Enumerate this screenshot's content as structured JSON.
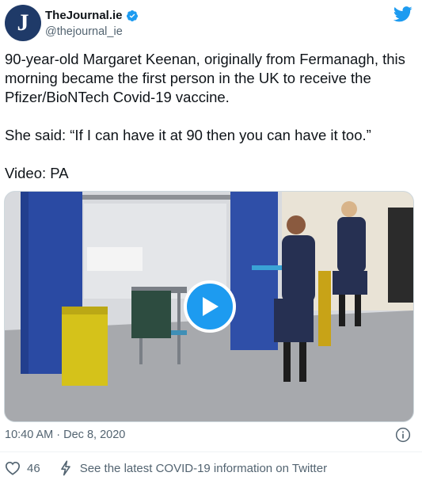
{
  "author": {
    "display_name": "TheJournal.ie",
    "handle": "@thejournal_ie",
    "avatar_letter": "J"
  },
  "tweet": {
    "paragraphs": [
      "90-year-old Margaret Keenan, originally from Fermanagh, this morning became the first person in the UK to receive the Pfizer/BioNTech Covid-19 vaccine.",
      "She said: “If I can have it at 90 then you can have it too.”",
      "Video: PA"
    ]
  },
  "meta": {
    "timestamp": "10:40 AM · Dec 8, 2020"
  },
  "actions": {
    "like_count": "46",
    "info_link": "See the latest COVID-19 information on Twitter"
  },
  "icons": {
    "verified": "verified-badge-icon",
    "bird": "twitter-bird-icon",
    "play": "play-icon",
    "info": "info-icon",
    "heart": "heart-icon",
    "bolt": "lightning-icon"
  },
  "colors": {
    "accent": "#1d9bf0",
    "text": "#0f1419",
    "secondary": "#536471",
    "avatar_bg": "#1f3a68"
  }
}
